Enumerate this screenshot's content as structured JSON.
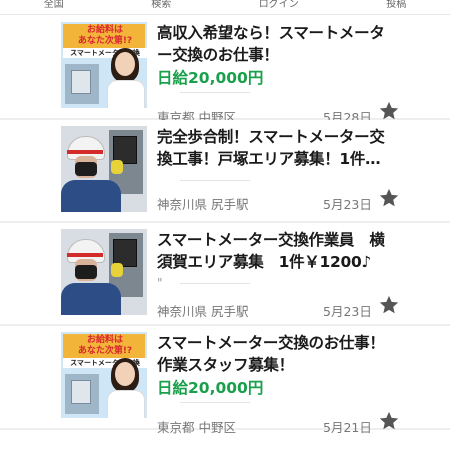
{
  "nav": [
    "全国",
    "検索",
    "ログイン",
    "投稿"
  ],
  "listings": [
    {
      "title": "高収入希望なら！スマートメーター交換のお仕事！",
      "pay": "日給20,000円",
      "location": "東京都 中野区",
      "date": "5月28日",
      "thumb": {
        "type": "ad",
        "line1": "お給料は",
        "line1b": "あなた次第!?",
        "line2": "スマートメーター交換"
      }
    },
    {
      "title": "完全歩合制！スマートメーター交換工事！戸塚エリア募集！1件…",
      "pay": "",
      "location": "神奈川県 尻手駅",
      "date": "5月23日",
      "thumb": {
        "type": "worker"
      }
    },
    {
      "title": "スマートメーター交換作業員　横須賀エリア募集　1件￥1200♪",
      "extra": "\"",
      "pay": "",
      "location": "神奈川県 尻手駅",
      "date": "5月23日",
      "thumb": {
        "type": "worker"
      }
    },
    {
      "title": "スマートメーター交換のお仕事！作業スタッフ募集！",
      "pay": "日給20,000円",
      "location": "東京都 中野区",
      "date": "5月21日",
      "thumb": {
        "type": "ad",
        "line1": "お給料は",
        "line1b": "あなた次第!?",
        "line2": "スマートメーター交換"
      }
    }
  ],
  "icons": {
    "favorite": "star-icon"
  },
  "colors": {
    "pay_green": "#1aa04c",
    "star": "#555555"
  }
}
